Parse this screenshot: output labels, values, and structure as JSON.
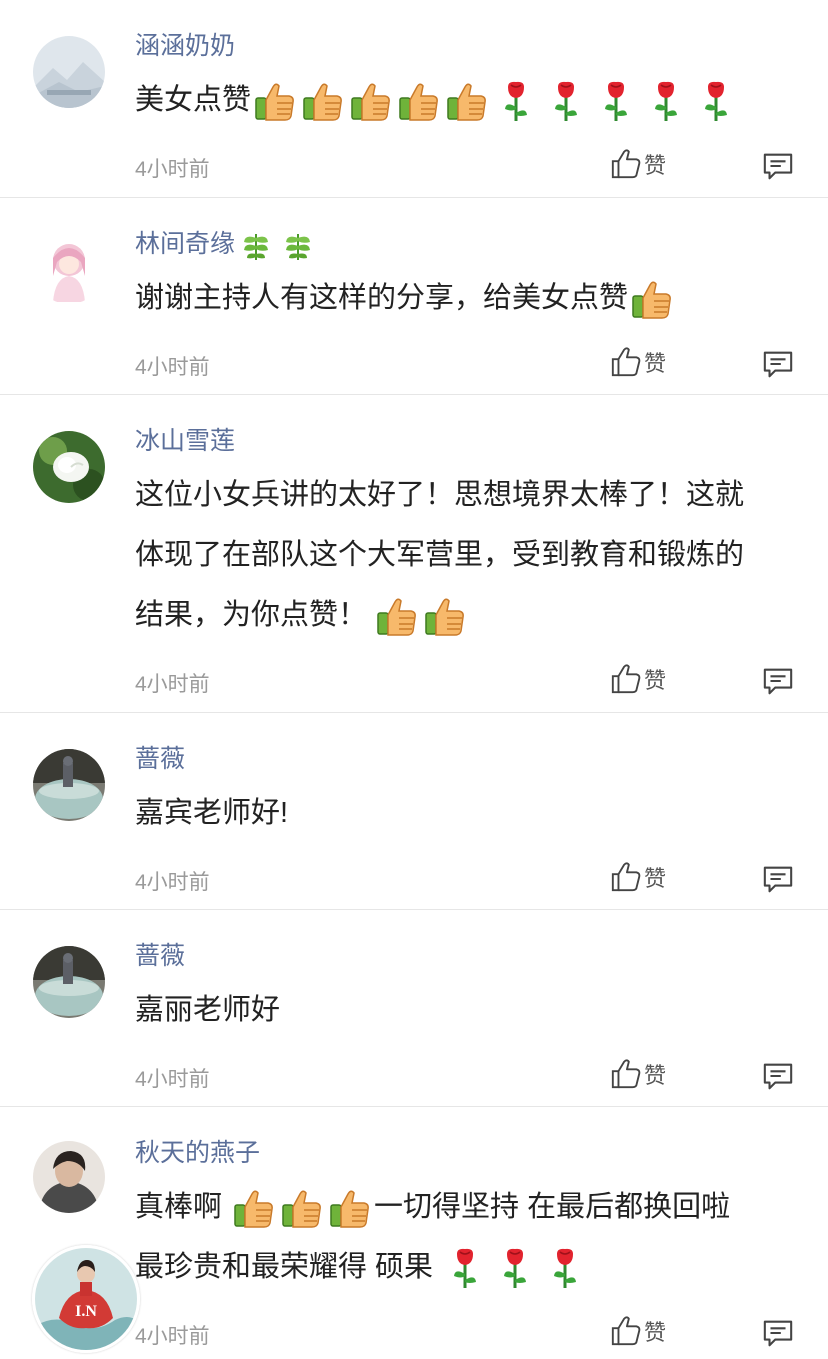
{
  "comments": [
    {
      "name": "涵涵奶奶",
      "text_parts": [
        "美女点赞"
      ],
      "time": "4小时前",
      "like_label": "赞"
    },
    {
      "name": "林间奇缘",
      "text": "谢谢主持人有这样的分享，给美女点赞",
      "time": "4小时前",
      "like_label": "赞"
    },
    {
      "name": "冰山雪莲",
      "lines": [
        "这位小女兵讲的太好了！思想境界太棒了！这就",
        "体现了在部队这个大军营里，受到教育和锻炼的",
        "结果，为你点赞！"
      ],
      "time": "4小时前",
      "like_label": "赞"
    },
    {
      "name": "蔷薇",
      "text": "嘉宾老师好!",
      "time": "4小时前",
      "like_label": "赞"
    },
    {
      "name": "蔷薇",
      "text": "嘉丽老师好",
      "time": "4小时前",
      "like_label": "赞"
    },
    {
      "name": "秋天的燕子",
      "line1_start": "真棒啊",
      "line1_end": "一切得坚持  在最后都换回啦",
      "line2": "最珍贵和最荣耀得  硕果",
      "time": "4小时前",
      "like_label": "赞"
    }
  ],
  "icons": {
    "like": "thumb-up-outline-icon",
    "reply": "comment-bubble-icon",
    "emoji_thumb": "thumbs-up-emoji-icon",
    "emoji_rose": "rose-emoji-icon",
    "emoji_leaf": "leaf-emoji-icon"
  },
  "colors": {
    "name": "#5b6f9a",
    "time": "#9a9a9a",
    "divider": "#e6e6e6"
  },
  "overlay_avatar_text": "I.N"
}
